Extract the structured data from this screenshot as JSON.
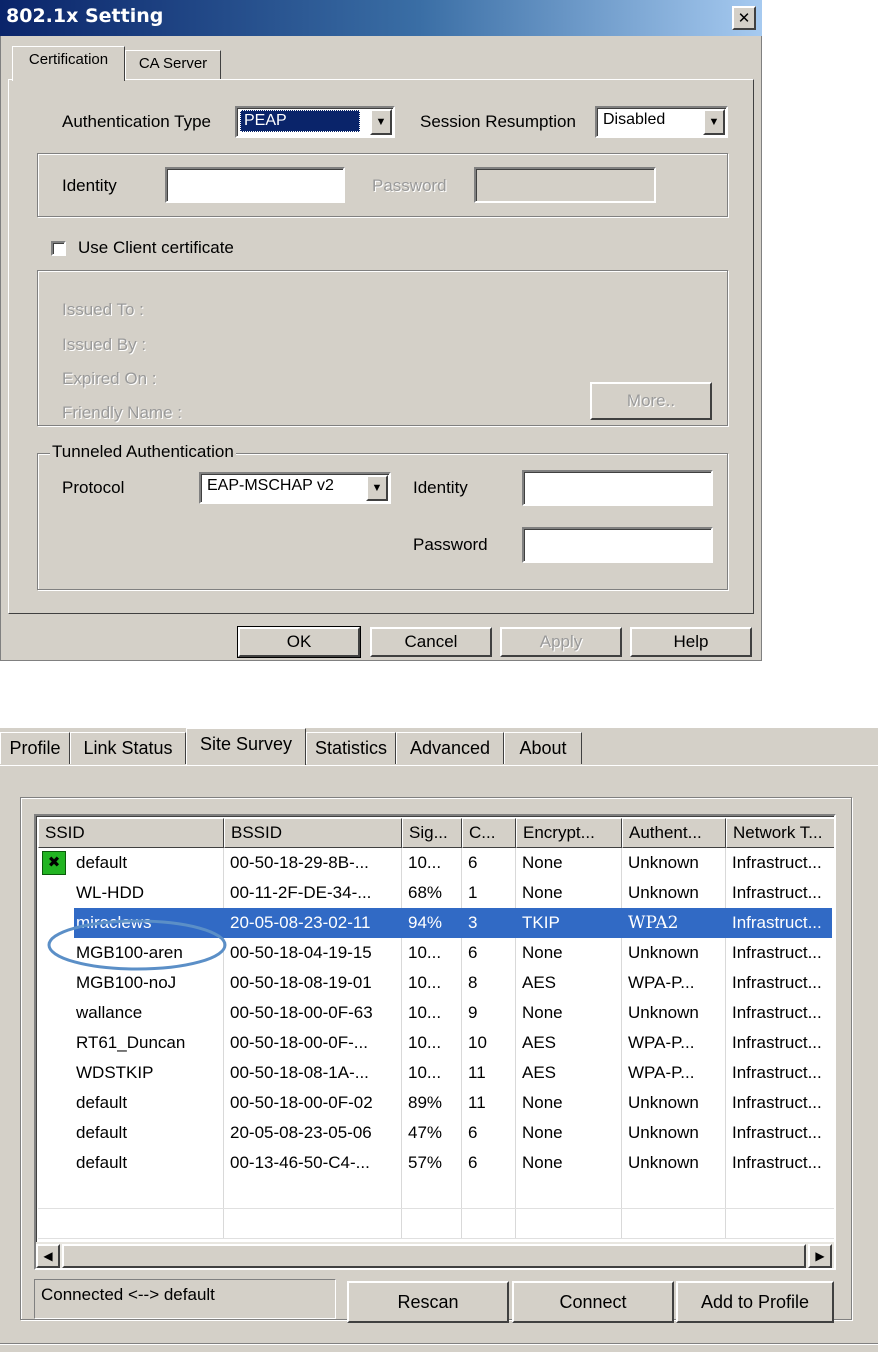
{
  "dialog": {
    "title": "802.1x Setting",
    "close_glyph": "✕",
    "tabs": [
      {
        "label": "Certification",
        "active": true
      },
      {
        "label": "CA Server",
        "active": false
      }
    ],
    "auth_type": {
      "label": "Authentication Type",
      "value": "PEAP"
    },
    "session": {
      "label": "Session Resumption",
      "value": "Disabled"
    },
    "identity": {
      "label": "Identity",
      "value": ""
    },
    "password": {
      "label": "Password",
      "value": ""
    },
    "use_client_cert": {
      "label": "Use Client certificate",
      "checked": false
    },
    "cert_info": {
      "issued_to": "Issued To :",
      "issued_by": "Issued By :",
      "expired_on": "Expired On :",
      "friendly_name": "Friendly Name :",
      "more_button": "More.."
    },
    "tunneled": {
      "group_label": "Tunneled Authentication",
      "protocol_label": "Protocol",
      "protocol_value": "EAP-MSCHAP v2",
      "identity_label": "Identity",
      "identity_value": "",
      "password_label": "Password",
      "password_value": ""
    },
    "buttons": {
      "ok": "OK",
      "cancel": "Cancel",
      "apply": "Apply",
      "help": "Help"
    }
  },
  "utility": {
    "tabs": [
      {
        "label": "Profile",
        "active": false
      },
      {
        "label": "Link Status",
        "active": false
      },
      {
        "label": "Site Survey",
        "active": true
      },
      {
        "label": "Statistics",
        "active": false
      },
      {
        "label": "Advanced",
        "active": false
      },
      {
        "label": "About",
        "active": false
      }
    ],
    "columns": [
      "SSID",
      "BSSID",
      "Sig...",
      "C...",
      "Encrypt...",
      "Authent...",
      "Network T..."
    ],
    "rows": [
      {
        "ssid": "default",
        "bssid": "00-50-18-29-8B-...",
        "signal": "10...",
        "channel": "6",
        "encryption": "None",
        "auth": "Unknown",
        "network_type": "Infrastruct...",
        "connected": true,
        "selected": false
      },
      {
        "ssid": "WL-HDD",
        "bssid": "00-11-2F-DE-34-...",
        "signal": "68%",
        "channel": "1",
        "encryption": "None",
        "auth": "Unknown",
        "network_type": "Infrastruct...",
        "connected": false,
        "selected": false
      },
      {
        "ssid": "miraclews",
        "bssid": "20-05-08-23-02-11",
        "signal": "94%",
        "channel": "3",
        "encryption": "TKIP",
        "auth": "WPA2",
        "network_type": "Infrastruct...",
        "connected": false,
        "selected": true
      },
      {
        "ssid": "MGB100-aren",
        "bssid": "00-50-18-04-19-15",
        "signal": "10...",
        "channel": "6",
        "encryption": "None",
        "auth": "Unknown",
        "network_type": "Infrastruct...",
        "connected": false,
        "selected": false
      },
      {
        "ssid": "MGB100-noJ",
        "bssid": "00-50-18-08-19-01",
        "signal": "10...",
        "channel": "8",
        "encryption": "AES",
        "auth": "WPA-P...",
        "network_type": "Infrastruct...",
        "connected": false,
        "selected": false
      },
      {
        "ssid": "wallance",
        "bssid": "00-50-18-00-0F-63",
        "signal": "10...",
        "channel": "9",
        "encryption": "None",
        "auth": "Unknown",
        "network_type": "Infrastruct...",
        "connected": false,
        "selected": false
      },
      {
        "ssid": "RT61_Duncan",
        "bssid": "00-50-18-00-0F-...",
        "signal": "10...",
        "channel": "10",
        "encryption": "AES",
        "auth": "WPA-P...",
        "network_type": "Infrastruct...",
        "connected": false,
        "selected": false
      },
      {
        "ssid": "WDSTKIP",
        "bssid": "00-50-18-08-1A-...",
        "signal": "10...",
        "channel": "11",
        "encryption": "AES",
        "auth": "WPA-P...",
        "network_type": "Infrastruct...",
        "connected": false,
        "selected": false
      },
      {
        "ssid": "default",
        "bssid": "00-50-18-00-0F-02",
        "signal": "89%",
        "channel": "11",
        "encryption": "None",
        "auth": "Unknown",
        "network_type": "Infrastruct...",
        "connected": false,
        "selected": false
      },
      {
        "ssid": "default",
        "bssid": "20-05-08-23-05-06",
        "signal": "47%",
        "channel": "6",
        "encryption": "None",
        "auth": "Unknown",
        "network_type": "Infrastruct...",
        "connected": false,
        "selected": false
      },
      {
        "ssid": "default",
        "bssid": "00-13-46-50-C4-...",
        "signal": "57%",
        "channel": "6",
        "encryption": "None",
        "auth": "Unknown",
        "network_type": "Infrastruct...",
        "connected": false,
        "selected": false
      }
    ],
    "status_text": "Connected <--> default",
    "buttons": {
      "rescan": "Rescan",
      "connect": "Connect",
      "add_profile": "Add to Profile"
    },
    "colors": {
      "selection": "#316ac5",
      "highlight_circle": "#5b8fc7",
      "connected_icon": "#22b422"
    }
  }
}
